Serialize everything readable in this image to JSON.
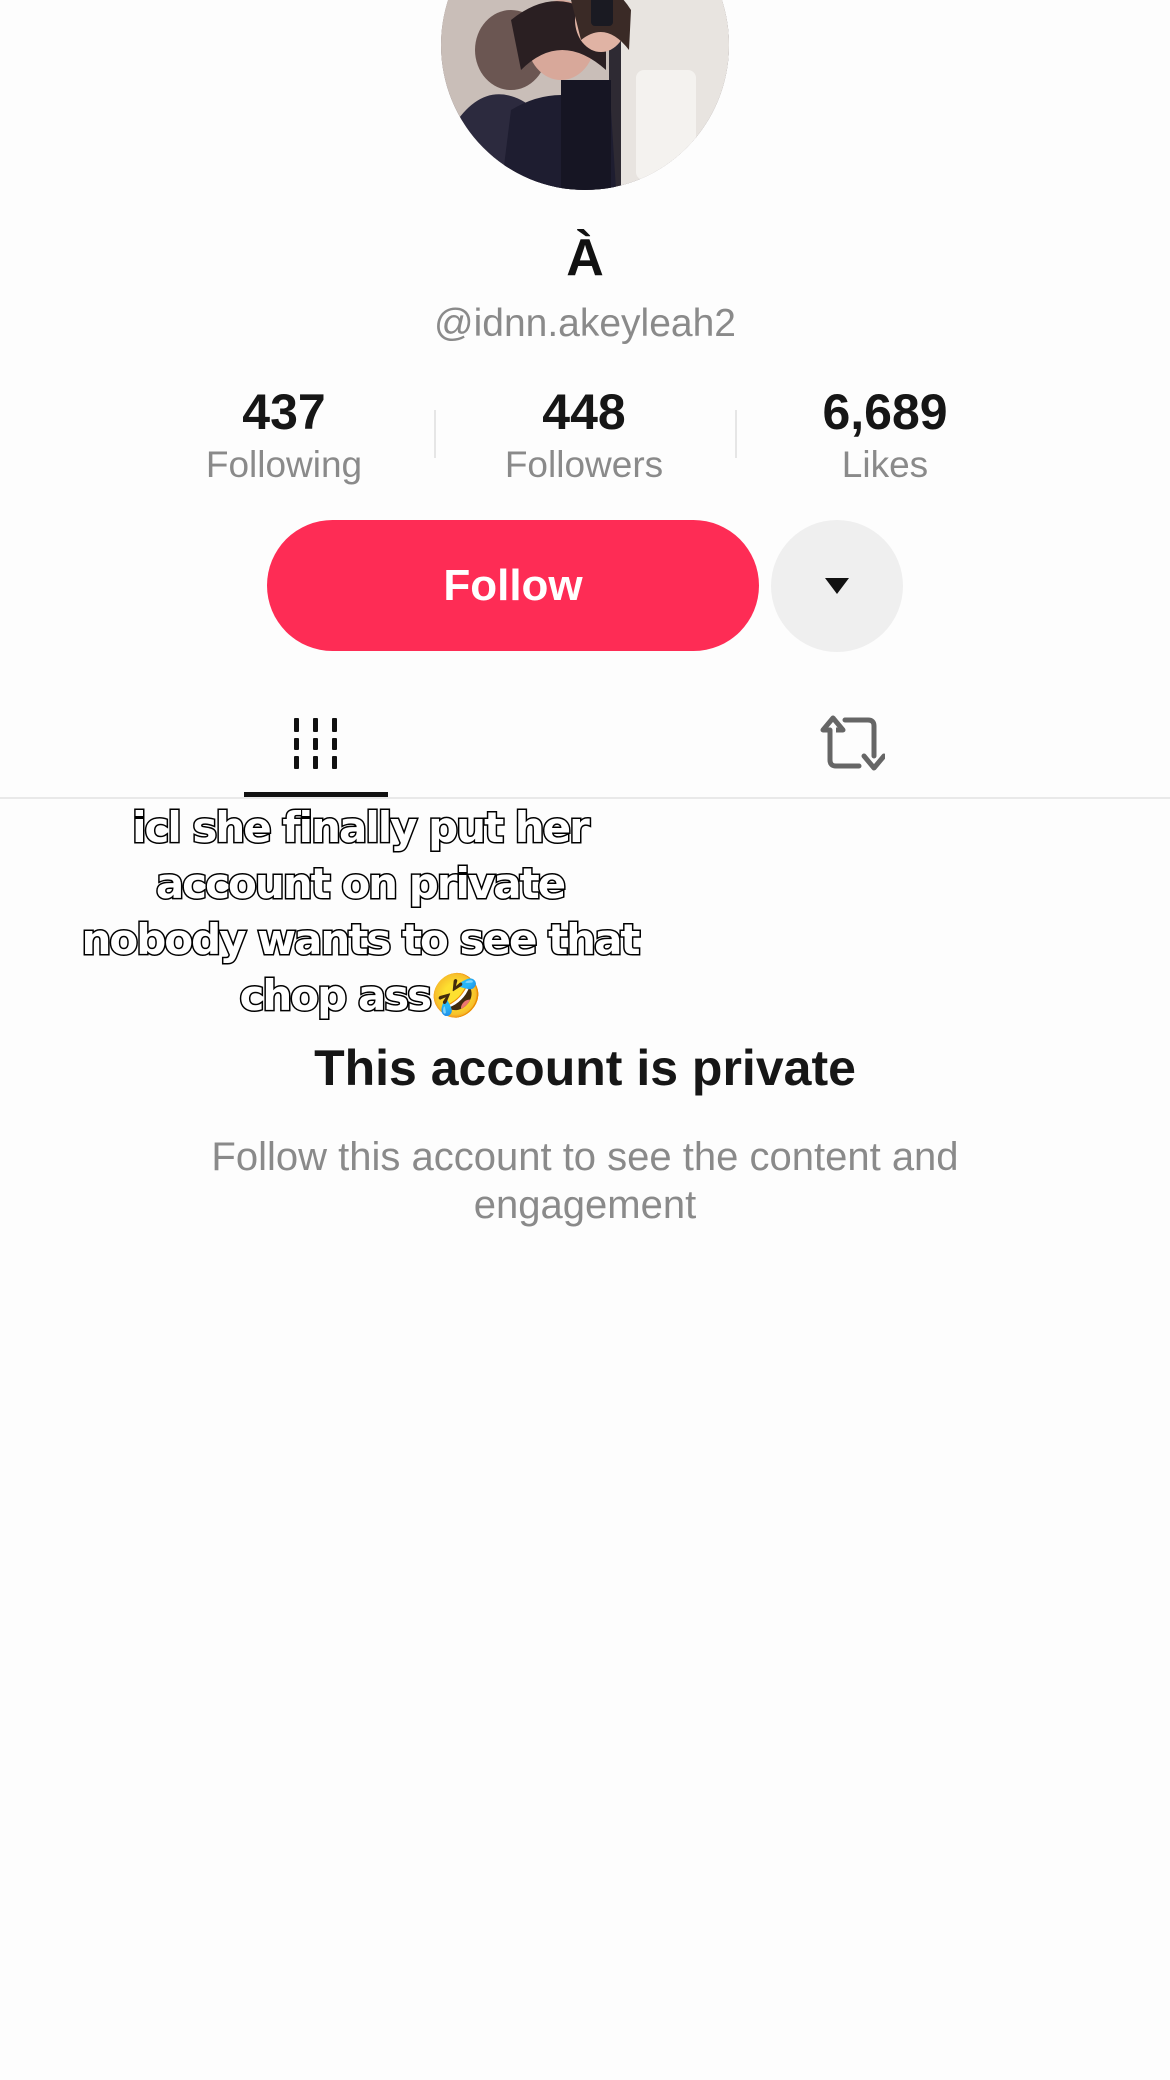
{
  "profile": {
    "display_name": "À",
    "username": "@idnn.akeyleah2"
  },
  "stats": {
    "following": {
      "value": "437",
      "label": "Following"
    },
    "followers": {
      "value": "448",
      "label": "Followers"
    },
    "likes": {
      "value": "6,689",
      "label": "Likes"
    }
  },
  "actions": {
    "follow_label": "Follow",
    "more_icon": "caret-down-icon"
  },
  "tabs": [
    {
      "name": "videos",
      "icon": "grid-icon",
      "active": true
    },
    {
      "name": "reposts",
      "icon": "repost-icon",
      "active": false
    }
  ],
  "overlay": {
    "caption": "icl she finally put her\naccount on private\nnobody wants to see that\nchop ass🤣"
  },
  "private_notice": {
    "title": "This account is private",
    "subtitle": "Follow this account to see the content and engagement"
  },
  "colors": {
    "follow_button": "#fe2c55",
    "secondary_text": "#8a8a8a",
    "more_button_bg": "#efefef"
  }
}
